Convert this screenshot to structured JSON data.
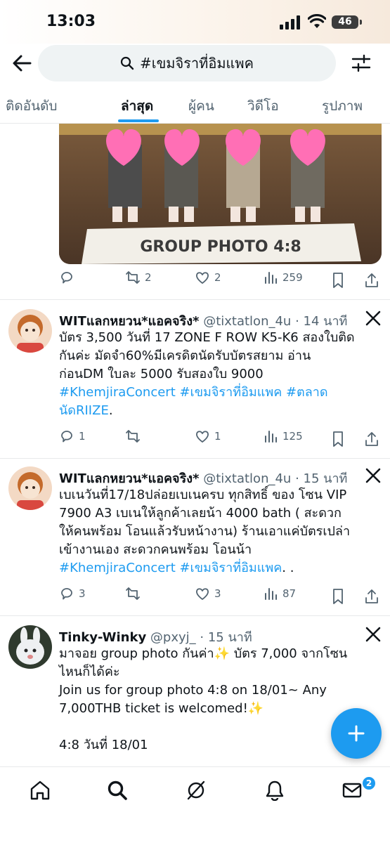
{
  "status_bar": {
    "time": "13:03",
    "battery": "46"
  },
  "header": {
    "search_query": "#เขมจิราที่อิมแพค",
    "icons": [
      "back-arrow-icon",
      "search-icon",
      "filter-icon"
    ]
  },
  "tabs": [
    {
      "label": "ติดอันดับ",
      "active": false
    },
    {
      "label": "ล่าสุด",
      "active": true
    },
    {
      "label": "ผู้คน",
      "active": false
    },
    {
      "label": "วิดีโอ",
      "active": false
    },
    {
      "label": "รูปภาพ",
      "active": false
    }
  ],
  "top_tweet": {
    "media_caption": "GROUP PHOTO 4:8",
    "stats": {
      "replies": "",
      "retweets": "2",
      "likes": "2",
      "views": "259"
    }
  },
  "tweets": [
    {
      "name": "WITแลกหยวน*แอคจริง*",
      "handle": "@tixtatlon_4u",
      "time": "· 14 นาที",
      "lines": [
        "บัตร 3,500 วันที่ 17 ZONE F  ROW K5-K6 สองใบติด",
        "กันค่ะ  มัดจำ60%มีเครดิตนัดรับบัตรสยาม อ่าน",
        "ก่อนDM   ใบละ 5000 รับสองใบ 9000"
      ],
      "hashtag_line_1": "#KhemjiraConcert #เขมจิราที่อิมแพค #ตลาด",
      "hashtag_line_2": "นัดRIIZE",
      "hashtag_line_2_suffix": ".",
      "stats": {
        "replies": "1",
        "retweets": "",
        "likes": "1",
        "views": "125"
      }
    },
    {
      "name": "WITแลกหยวน*แอคจริง*",
      "handle": "@tixtatlon_4u",
      "time": "· 15 นาที",
      "lines": [
        "เบเนวันที่17/18ปล่อยเบเนครบ ทุกสิทธิ์ ของ โซน VIP",
        "7900 A3 เบเนให้ลูกค้าเลยน้า  4000 bath ( สะดวก",
        "ให้คนพร้อม โอนแล้วรับหน้างาน) ร้านเอาแค่บัตรเปล่า",
        "เข้างานเอง สะดวกคนพร้อม โอนน้า"
      ],
      "hashtag_line_1": "#KhemjiraConcert  #เขมจิราที่อิมแพค",
      "hashtag_line_1_suffix": ". .",
      "stats": {
        "replies": "3",
        "retweets": "",
        "likes": "3",
        "views": "87"
      }
    },
    {
      "name": "Tinky-Winky",
      "handle": "@pxyj_",
      "time": "· 15 นาที",
      "lines": [
        "มาจอย group photo กันค่า✨ บัตร 7,000 จากโซน",
        "ไหนก็ได้ค่ะ",
        "Join us for group photo 4:8 on 18/01~ Any",
        "7,000THB ticket is welcomed!✨",
        "",
        "4:8 วันที่ 18/01"
      ]
    }
  ],
  "bottom_nav": {
    "items": [
      "home-icon",
      "search-icon",
      "grok-icon",
      "notifications-icon",
      "messages-icon"
    ],
    "messages_badge": "2"
  },
  "colors": {
    "accent": "#1d9bf0",
    "text": "#0f1419",
    "muted": "#536471"
  }
}
